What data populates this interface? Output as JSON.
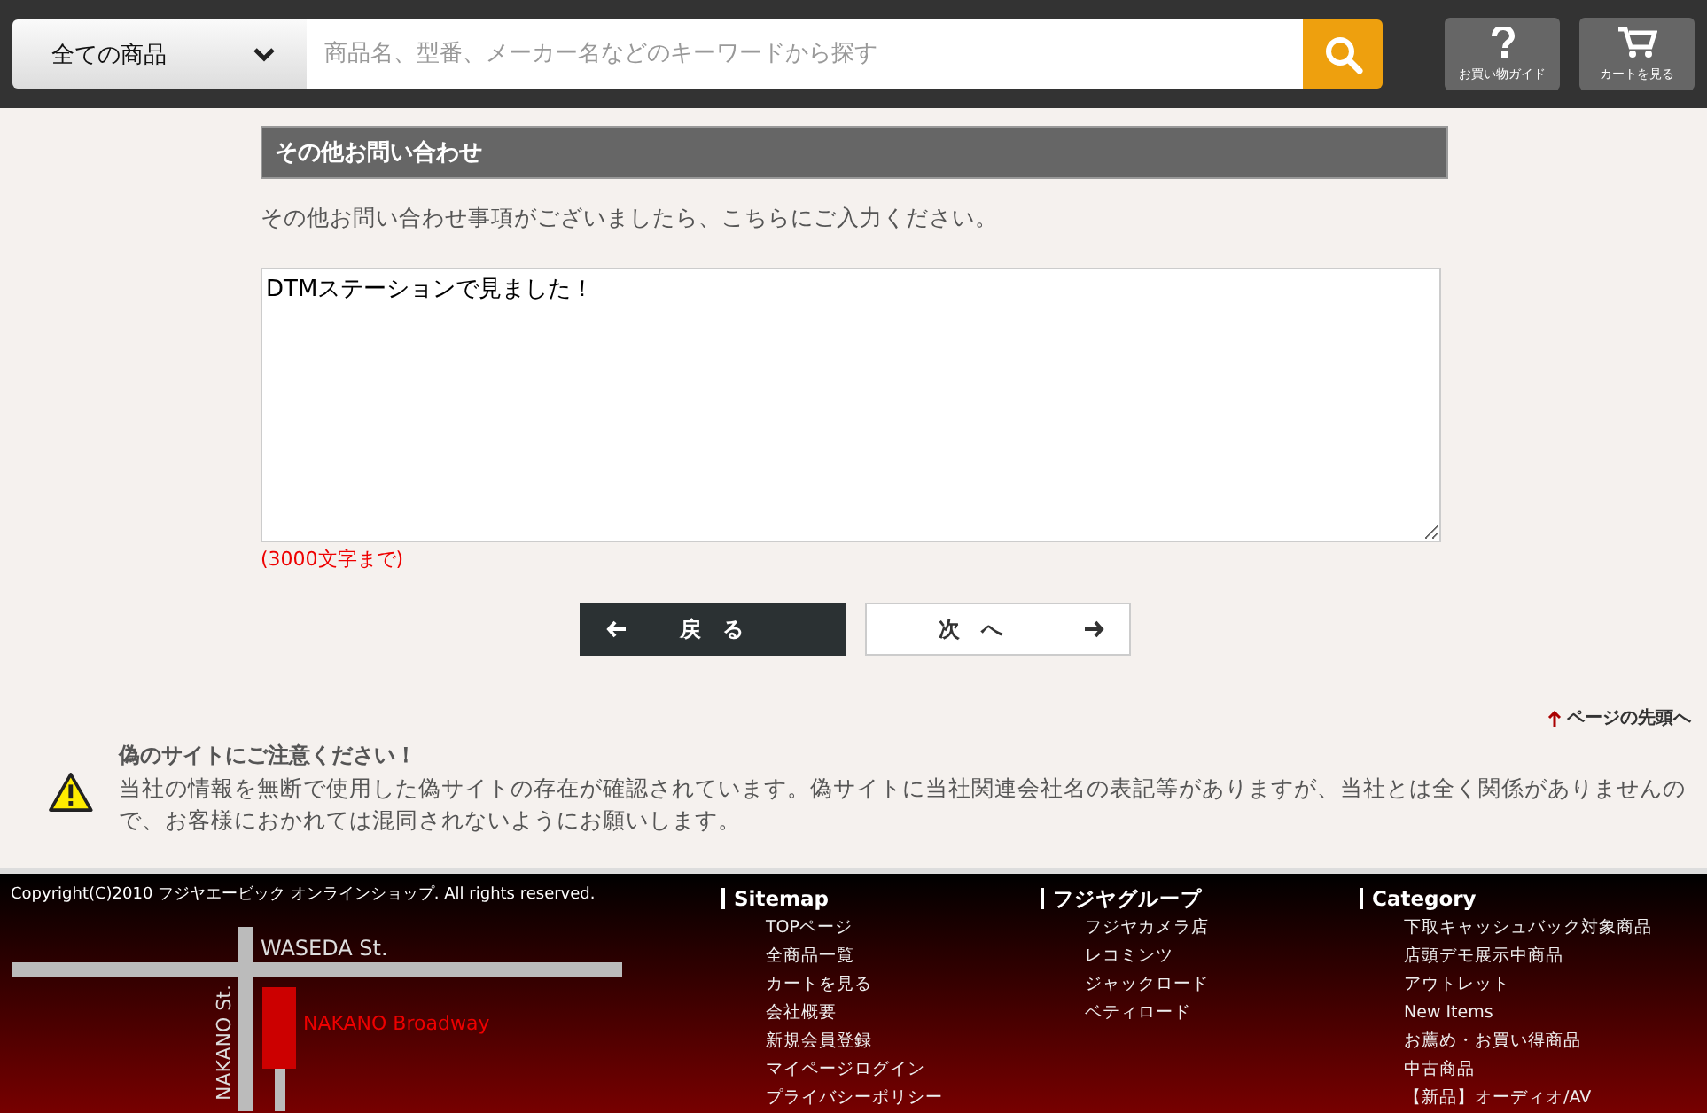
{
  "header": {
    "category_select": "全ての商品",
    "search": {
      "placeholder": "商品名、型番、メーカー名などのキーワードから探す"
    },
    "buttons": [
      {
        "kind": "guide",
        "label": "お買い物ガイド"
      },
      {
        "kind": "cart",
        "label": "カートを見る"
      }
    ]
  },
  "form": {
    "section_title": "その他お問い合わせ",
    "instruction": "その他お問い合わせ事項がございましたら、こちらにご入力ください。",
    "textarea_value": "DTMステーションで見ました！",
    "limit_note": "(3000文字まで)",
    "back_button": "戻　る",
    "next_button": "次　へ"
  },
  "page_top_link": "ページの先頭へ",
  "notice": {
    "title": "偽のサイトにご注意ください！",
    "body": "当社の情報を無断で使用した偽サイトの存在が確認されています。偽サイトに当社関連会社名の表記等がありますが、当社とは全く関係がありませんので、お客様におかれては混同されないようにお願いします。"
  },
  "footer": {
    "copyright": "Copyright(C)2010 フジヤエービック オンラインショップ. All rights reserved.",
    "map": {
      "street_top": "WASEDA St.",
      "street_side": "NAKANO St.",
      "landmark": "NAKANO Broadway"
    },
    "columns": [
      {
        "title": "Sitemap",
        "links": [
          "TOPページ",
          "全商品一覧",
          "カートを見る",
          "会社概要",
          "新規会員登録",
          "マイページログイン",
          "プライバシーポリシー"
        ]
      },
      {
        "title": "フジヤグループ",
        "links": [
          "フジヤカメラ店",
          "レコミンツ",
          "ジャックロード",
          "ベティロード"
        ]
      },
      {
        "title": "Category",
        "links": [
          "下取キャッシュバック対象商品",
          "店頭デモ展示中商品",
          "アウトレット",
          "New Items",
          "お薦め・お買い得商品",
          "中古商品",
          "【新品】オーディオ/AV"
        ]
      }
    ]
  }
}
